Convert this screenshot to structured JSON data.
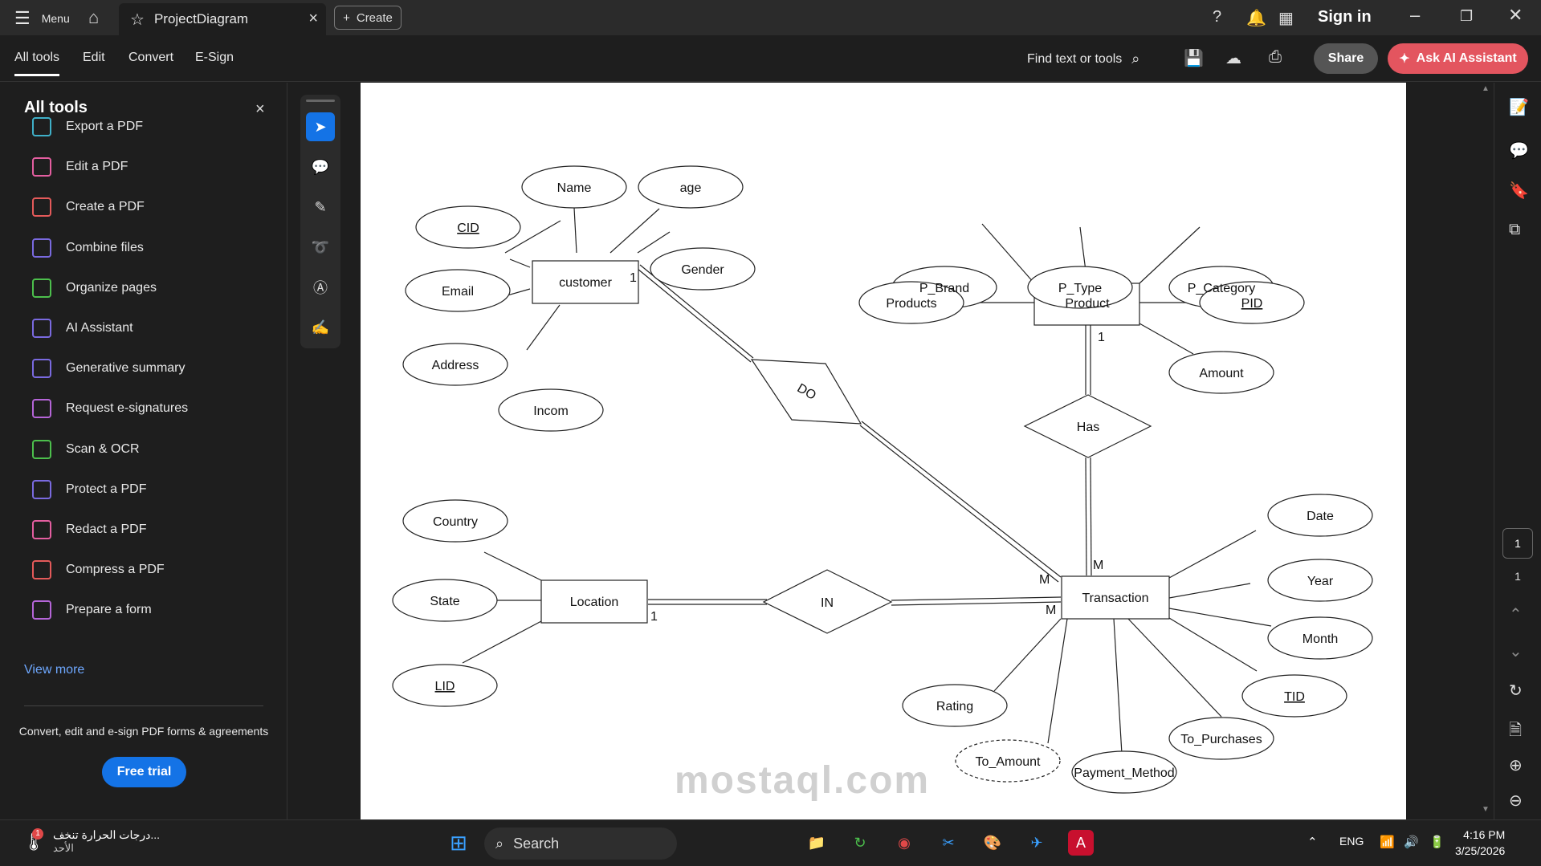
{
  "titlebar": {
    "menu_label": "Menu",
    "tab_title": "ProjectDiagram",
    "create_label": "Create",
    "sign_in": "Sign in"
  },
  "toolbar": {
    "tabs": [
      "All tools",
      "Edit",
      "Convert",
      "E-Sign"
    ],
    "find_label": "Find text or tools",
    "share_label": "Share",
    "ai_label": "Ask AI Assistant"
  },
  "sidepanel": {
    "title": "All tools",
    "items": [
      {
        "label": "Export a PDF",
        "icon": "export-pdf-icon",
        "color": "#3fb0c8"
      },
      {
        "label": "Edit a PDF",
        "icon": "edit-pdf-icon",
        "color": "#e45ea0"
      },
      {
        "label": "Create a PDF",
        "icon": "create-pdf-icon",
        "color": "#e45a5a"
      },
      {
        "label": "Combine files",
        "icon": "combine-files-icon",
        "color": "#7a6ae0"
      },
      {
        "label": "Organize pages",
        "icon": "organize-pages-icon",
        "color": "#4cbf4c"
      },
      {
        "label": "AI Assistant",
        "icon": "ai-assistant-icon",
        "color": "#7a6ae0"
      },
      {
        "label": "Generative summary",
        "icon": "generative-summary-icon",
        "color": "#7a6ae0"
      },
      {
        "label": "Request e-signatures",
        "icon": "request-esignatures-icon",
        "color": "#b565d8"
      },
      {
        "label": "Scan & OCR",
        "icon": "scan-ocr-icon",
        "color": "#4cbf4c"
      },
      {
        "label": "Protect a PDF",
        "icon": "protect-pdf-icon",
        "color": "#7a6ae0"
      },
      {
        "label": "Redact a PDF",
        "icon": "redact-pdf-icon",
        "color": "#e45ea0"
      },
      {
        "label": "Compress a PDF",
        "icon": "compress-pdf-icon",
        "color": "#e45a5a"
      },
      {
        "label": "Prepare a form",
        "icon": "prepare-form-icon",
        "color": "#b565d8"
      }
    ],
    "view_more": "View more",
    "promo": "Convert, edit and e-sign PDF forms & agreements",
    "trial_label": "Free trial"
  },
  "diagram": {
    "entities": {
      "customer": "customer",
      "product": "Product",
      "location": "Location",
      "transaction": "Transaction"
    },
    "relationships": {
      "do": "DO",
      "has": "Has",
      "in": "IN"
    },
    "attributes": {
      "cid": "CID",
      "name": "Name",
      "age": "age",
      "gender": "Gender",
      "email": "Email",
      "address": "Address",
      "incom": "Incom",
      "p_brand": "P_Brand",
      "p_type": "P_Type",
      "p_category": "P_Category",
      "products": "Products",
      "pid": "PID",
      "amount": "Amount",
      "country": "Country",
      "state": "State",
      "lid": "LID",
      "date": "Date",
      "year": "Year",
      "month": "Month",
      "tid": "TID",
      "to_purchases": "To_Purchases",
      "payment_method": "Payment_Method",
      "to_amount": "To_Amount",
      "rating": "Rating"
    },
    "cardinality": {
      "customer_do": "1",
      "product_has": "1",
      "location_in": "1",
      "trans_do": "M",
      "trans_has": "M",
      "trans_in": "M"
    }
  },
  "rightrail": {
    "page_current": "1",
    "page_total": "1"
  },
  "taskbar": {
    "weather_text": "درجات الحرارة تنخف...",
    "weather_sub": "الأحد",
    "weather_badge": "1",
    "search_label": "Search",
    "lang": "ENG",
    "time": "4:16 PM",
    "date": "3/25/2026"
  },
  "watermark": "mostaql.com"
}
